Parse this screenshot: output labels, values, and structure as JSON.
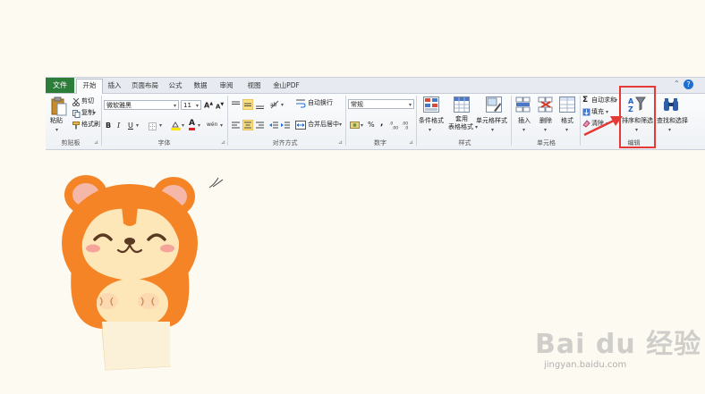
{
  "tabs": [
    {
      "label": "文件"
    },
    {
      "label": "开始"
    },
    {
      "label": "插入"
    },
    {
      "label": "页面布局"
    },
    {
      "label": "公式"
    },
    {
      "label": "数据"
    },
    {
      "label": "审阅"
    },
    {
      "label": "视图"
    },
    {
      "label": "金山PDF"
    }
  ],
  "clipboard": {
    "paste": "粘贴",
    "cut": "剪切",
    "copy": "复制",
    "format_painter": "格式刷",
    "group": "剪贴板"
  },
  "font": {
    "name": "微软雅黑",
    "size": "11",
    "bold": "B",
    "italic": "I",
    "underline": "U",
    "grow": "A",
    "shrink": "A",
    "font_color": "A",
    "phonetic": "wén",
    "group": "字体"
  },
  "alignment": {
    "wrap_text": "自动换行",
    "merge_center": "合并后居中",
    "group": "对齐方式"
  },
  "number": {
    "format": "常规",
    "percent": "%",
    "comma": ",",
    "group": "数字"
  },
  "styles": {
    "conditional": "条件格式",
    "format_table_1": "套用",
    "format_table_2": "表格格式",
    "cell_styles": "单元格样式",
    "group": "样式"
  },
  "cells": {
    "insert": "插入",
    "delete": "删除",
    "format": "格式",
    "group": "单元格"
  },
  "editing": {
    "autosum": "自动求和",
    "fill": "填充",
    "clear": "清除",
    "sort_filter": "排序和筛选",
    "find_select": "查找和选择",
    "group": "编辑"
  },
  "watermark": {
    "brand": "Bai du 经验",
    "url": "jingyan.baidu.com"
  },
  "colors": {
    "file_tab": "#2d7d3a",
    "highlight": "#e53935",
    "accent_blue": "#1f6fd1"
  }
}
